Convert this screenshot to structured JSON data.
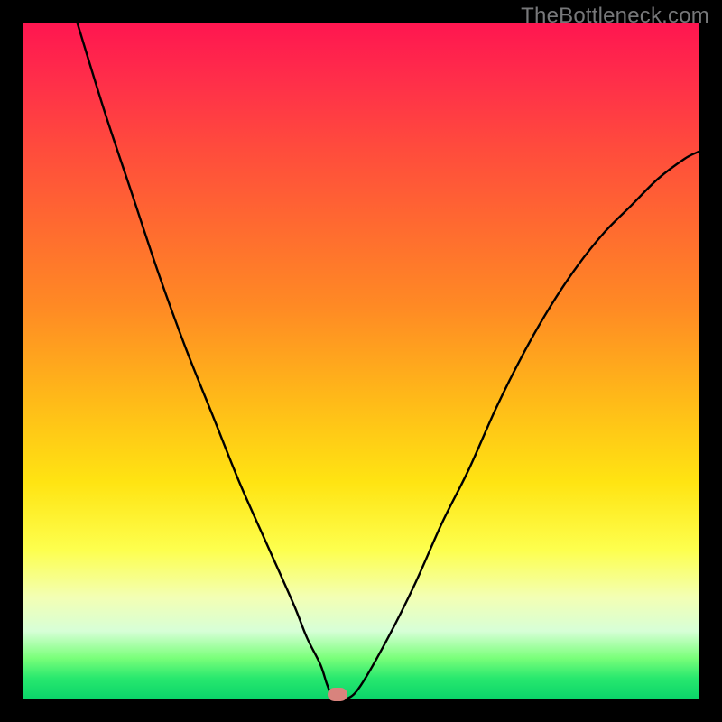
{
  "watermark": "TheBottleneck.com",
  "colors": {
    "top": "#ff1650",
    "bottom": "#0bd46a",
    "curve": "#000000",
    "marker": "#d8837d",
    "frame": "#000000"
  },
  "chart_data": {
    "type": "line",
    "title": "",
    "xlabel": "",
    "ylabel": "",
    "xlim": [
      0,
      100
    ],
    "ylim": [
      0,
      100
    ],
    "grid": false,
    "legend": false,
    "series": [
      {
        "name": "bottleneck-curve",
        "x": [
          8,
          12,
          16,
          20,
          24,
          28,
          32,
          36,
          40,
          42,
          44,
          45,
          46,
          48,
          50,
          54,
          58,
          62,
          66,
          70,
          74,
          78,
          82,
          86,
          90,
          94,
          98,
          100
        ],
        "y": [
          100,
          87,
          75,
          63,
          52,
          42,
          32,
          23,
          14,
          9,
          5,
          2,
          0,
          0,
          2,
          9,
          17,
          26,
          34,
          43,
          51,
          58,
          64,
          69,
          73,
          77,
          80,
          81
        ]
      }
    ],
    "marker": {
      "x": 46.5,
      "y": 0
    }
  }
}
